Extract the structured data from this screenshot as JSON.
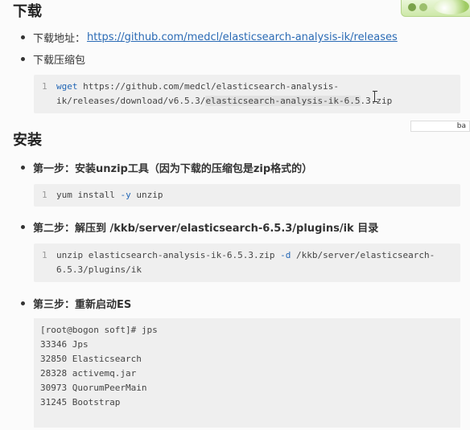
{
  "download": {
    "heading": "下载",
    "address_label": "下载地址：",
    "address_link": "https://github.com/medcl/elasticsearch-analysis-ik/releases",
    "package_label": "下载压缩包",
    "code": {
      "line_no": "1",
      "cmd": "wget",
      "line1_rest": " https://github.com/medcl/elasticsearch-analysis-",
      "line2_pre": "ik/releases/download/v6.5.3/",
      "line2_hl": "elasticsearch-analysis-ik-6.5",
      "line2_post": ".3.zip"
    }
  },
  "install": {
    "heading": "安装",
    "step1": {
      "label": "第一步：安装unzip工具（因为下载的压缩包是zip格式的）",
      "line_no": "1",
      "code_pre": "yum install ",
      "code_flag": "-y",
      "code_post": " unzip"
    },
    "step2": {
      "label": "第二步：解压到 /kkb/server/elasticsearch-6.5.3/plugins/ik 目录",
      "line_no": "1",
      "line1_pre": "unzip elasticsearch-analysis-ik-6.5.3.zip ",
      "line1_flag": "-d",
      "line1_post": " /kkb/server/elasticsearch-",
      "line2": "6.5.3/plugins/ik"
    },
    "step3": {
      "label": "第三步：重新启动ES",
      "terminal": [
        "[root@bogon soft]# jps",
        "33346 Jps",
        "32850 Elasticsearch",
        "28328 activemq.jar",
        "30973 QuorumPeerMain",
        "31245 Bootstrap"
      ]
    }
  },
  "overlay_button": "ba"
}
